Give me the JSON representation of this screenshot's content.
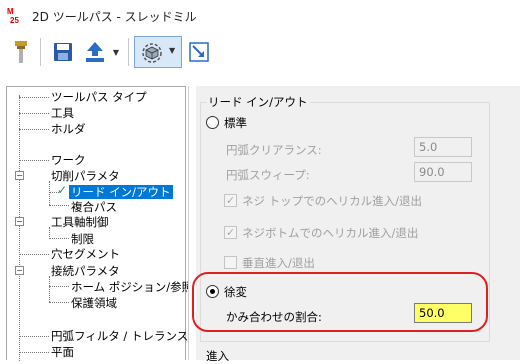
{
  "window": {
    "title": "2D ツールパス - スレッドミル"
  },
  "toolbar": {
    "dropdown_glyph": "▼"
  },
  "tree": {
    "items": [
      {
        "label": "ツールパス タイプ"
      },
      {
        "label": "工具"
      },
      {
        "label": "ホルダ"
      },
      {
        "label": "ワーク"
      },
      {
        "label": "切削パラメタ"
      },
      {
        "label": "リード イン/アウト",
        "selected": true
      },
      {
        "label": "複合パス"
      },
      {
        "label": "工具軸制御"
      },
      {
        "label": "制限"
      },
      {
        "label": "穴セグメント"
      },
      {
        "label": "接続パラメタ"
      },
      {
        "label": "ホーム ポジション/参照点"
      },
      {
        "label": "保護領域"
      },
      {
        "label": "円弧フィルタ / トレランス"
      },
      {
        "label": "平面"
      }
    ],
    "expander_glyph": "−"
  },
  "lead": {
    "group_title": "リード イン/アウト",
    "standard_label": "標準",
    "arc_clearance_label": "円弧クリアランス:",
    "arc_clearance_value": "5.0",
    "arc_sweep_label": "円弧スウィープ:",
    "arc_sweep_value": "90.0",
    "helical_top_label": "ネジ トップでのヘリカル進入/退出",
    "helical_top_checked": true,
    "helical_bottom_label": "ネジボトムでのヘリカル進入/退出",
    "helical_bottom_checked": true,
    "vertical_label": "垂直進入/退出",
    "vertical_checked": false,
    "gradual_label": "徐変",
    "engagement_label": "かみ合わせの割合:",
    "engagement_value": "50.0",
    "selected_mode": "gradual",
    "check_glyph": "✓"
  },
  "entry_section": {
    "title": "進入"
  }
}
